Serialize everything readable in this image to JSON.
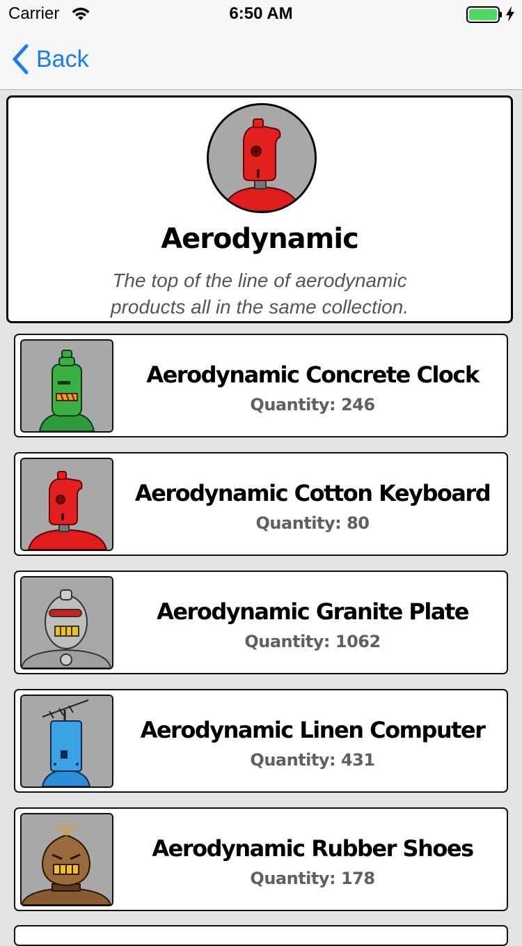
{
  "status_bar": {
    "carrier": "Carrier",
    "time": "6:50 AM",
    "battery_color": "#4cd964"
  },
  "nav": {
    "back_label": "Back",
    "tint": "#1a7cf5"
  },
  "category": {
    "title": "Aerodynamic",
    "description": "The top of the line of aerodynamic products all in the same collection.",
    "avatar_icon": "red-robot-icon"
  },
  "products": [
    {
      "name": "Aerodynamic Concrete Clock",
      "quantity": "Quantity: 246",
      "icon": "green-robot-icon"
    },
    {
      "name": "Aerodynamic Cotton Keyboard",
      "quantity": "Quantity: 80",
      "icon": "red-robot-icon"
    },
    {
      "name": "Aerodynamic Granite Plate",
      "quantity": "Quantity: 1062",
      "icon": "silver-robot-icon"
    },
    {
      "name": "Aerodynamic Linen Computer",
      "quantity": "Quantity: 431",
      "icon": "blue-robot-icon"
    },
    {
      "name": "Aerodynamic Rubber Shoes",
      "quantity": "Quantity: 178",
      "icon": "brown-robot-icon"
    }
  ]
}
